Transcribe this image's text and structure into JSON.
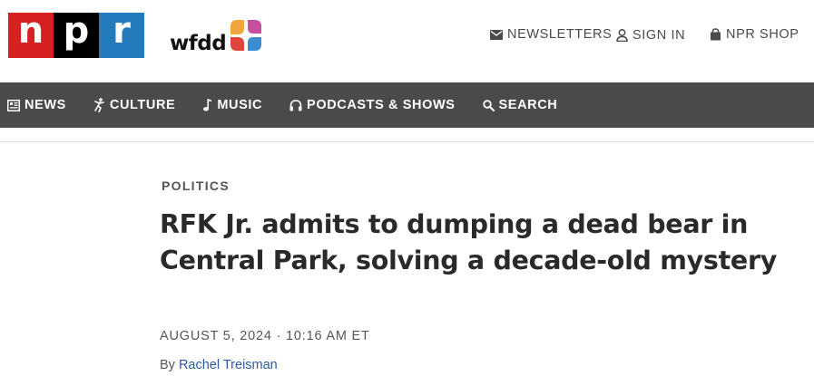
{
  "header": {
    "logo_letters": [
      "n",
      "p",
      "r"
    ],
    "station_name": "wfdd",
    "utility_links": {
      "newsletters": "NEWSLETTERS",
      "sign_in": "SIGN IN",
      "shop": "NPR SHOP"
    }
  },
  "nav": {
    "items": [
      {
        "label": "NEWS",
        "icon": "news-icon"
      },
      {
        "label": "CULTURE",
        "icon": "culture-icon"
      },
      {
        "label": "MUSIC",
        "icon": "music-note-icon"
      },
      {
        "label": "PODCASTS & SHOWS",
        "icon": "headphones-icon"
      },
      {
        "label": "SEARCH",
        "icon": "search-icon"
      }
    ]
  },
  "article": {
    "section": "POLITICS",
    "headline": "RFK Jr. admits to dumping a dead bear in Central Park, solving a decade-old mystery",
    "date": "AUGUST 5, 2024 · 10:16 AM ET",
    "byline_prefix": "By",
    "author": "Rachel Treisman"
  },
  "colors": {
    "npr_red": "#d62021",
    "npr_black": "#000000",
    "npr_blue": "#237bbd",
    "nav_bg": "#4a4a4a",
    "author_link": "#2a5aa8"
  }
}
